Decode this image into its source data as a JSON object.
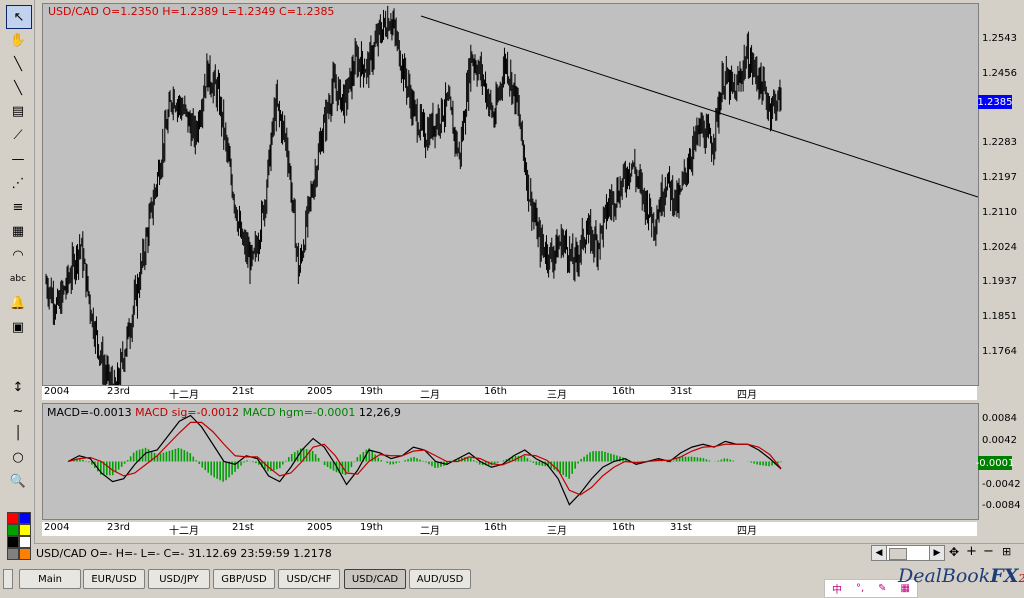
{
  "toolbar": {
    "tools": [
      {
        "name": "pointer-tool",
        "glyph": "↖",
        "selected": true
      },
      {
        "name": "hand-tool",
        "glyph": "✋"
      },
      {
        "name": "trendline-tool",
        "glyph": "╲"
      },
      {
        "name": "ray-tool",
        "glyph": "╲"
      },
      {
        "name": "horizontal-lines-tool",
        "glyph": "▤"
      },
      {
        "name": "fan-tool",
        "glyph": "⟋"
      },
      {
        "name": "hline-tool",
        "glyph": "—"
      },
      {
        "name": "gann-fan-tool",
        "glyph": "⋰"
      },
      {
        "name": "fibonacci-tool",
        "glyph": "≡"
      },
      {
        "name": "grid-tool",
        "glyph": "▦"
      },
      {
        "name": "arc-tool",
        "glyph": "◠"
      },
      {
        "name": "text-tool",
        "glyph": "abc"
      },
      {
        "name": "alert-tool",
        "glyph": "🔔"
      },
      {
        "name": "calculator-tool",
        "glyph": "▣"
      },
      {
        "name": "arrows-tool",
        "glyph": "↕"
      },
      {
        "name": "wave-tool",
        "glyph": "∼"
      },
      {
        "name": "vline-tool",
        "glyph": "│"
      },
      {
        "name": "circle-tool",
        "glyph": "○"
      },
      {
        "name": "zoom-tool",
        "glyph": "🔍"
      }
    ],
    "colors": [
      "#ff0000",
      "#0000ff",
      "#00a000",
      "#ffff00",
      "#000000",
      "#ffffff",
      "#808080",
      "#ff8000"
    ]
  },
  "main_chart": {
    "info": "USD/CAD O=1.2350 H=1.2389 L=1.2349 C=1.2385",
    "price_labels": [
      "1.2543",
      "1.2456",
      "1.2283",
      "1.2197",
      "1.2110",
      "1.2024",
      "1.1937",
      "1.1851",
      "1.1764"
    ],
    "current_price": "1.2385",
    "current_color": "#0000ff"
  },
  "macd_chart": {
    "info_macd": "MACD=-0.0013",
    "info_sig": "MACD sig=-0.0012",
    "info_hgm": "MACD hgm=-0.0001",
    "info_params": "12,26,9",
    "value_labels": [
      "0.0084",
      "0.0042",
      "-0.0042",
      "-0.0084"
    ],
    "current_value": "-0.0001",
    "current_color": "#008000"
  },
  "date_labels": [
    "2004",
    "23rd",
    "十二月",
    "21st",
    "2005",
    "19th",
    "二月",
    "16th",
    "三月",
    "16th",
    "31st",
    "四月"
  ],
  "status": {
    "text": "USD/CAD O=- H=- L=- C=-    31.12.69 23:59:59 1.2178",
    "zoom_plus": "+",
    "zoom_minus": "−"
  },
  "tabs": [
    "Main",
    "EUR/USD",
    "USD/JPY",
    "GBP/USD",
    "USD/CHF",
    "USD/CAD",
    "AUD/USD"
  ],
  "active_tab": 5,
  "brand": {
    "name": "DealBook",
    "suffix": "FX",
    "version": "2"
  },
  "chart_data": [
    {
      "type": "bar",
      "title": "USD/CAD O=1.2350 H=1.2389 L=1.2349 C=1.2385",
      "x": [
        "2004",
        "23rd",
        "十二月",
        "21st",
        "2005",
        "19th",
        "二月",
        "16th",
        "三月",
        "16th",
        "31st",
        "四月"
      ],
      "ylim": [
        1.172,
        1.261
      ],
      "series": [
        {
          "values": [
            1.196,
            1.19,
            1.197,
            1.205,
            1.188,
            1.176,
            1.17,
            1.182,
            1.195,
            1.21,
            1.225,
            1.24,
            1.236,
            1.23,
            1.245,
            1.24,
            1.222,
            1.206,
            1.2,
            1.214,
            1.238,
            1.228,
            1.198,
            1.215,
            1.23,
            1.242,
            1.238,
            1.248,
            1.246,
            1.254,
            1.258,
            1.247,
            1.236,
            1.23,
            1.234,
            1.238,
            1.225,
            1.249,
            1.244,
            1.234,
            1.248,
            1.238,
            1.218,
            1.205,
            1.202,
            1.206,
            1.2,
            1.208,
            1.205,
            1.214,
            1.218,
            1.224,
            1.216,
            1.21,
            1.22,
            1.214,
            1.225,
            1.232,
            1.228,
            1.244,
            1.24,
            1.249,
            1.244,
            1.237,
            1.239
          ]
        }
      ],
      "trendline": [
        [
          1,
          1.2595
        ],
        [
          96,
          1.2175
        ]
      ]
    },
    {
      "type": "line",
      "ylim": [
        -0.01,
        0.01
      ],
      "series": [
        {
          "name": "MACD",
          "values": [
            0.0,
            0.001,
            0.0005,
            -0.002,
            -0.0035,
            -0.003,
            -0.0005,
            0.0015,
            0.002,
            0.0045,
            0.007,
            0.008,
            0.006,
            0.003,
            0.0,
            -0.0005,
            0.001,
            0.0005,
            -0.0025,
            -0.0035,
            -0.001,
            0.002,
            0.004,
            0.0025,
            -0.0005,
            -0.004,
            -0.0015,
            0.002,
            0.0015,
            0.0005,
            0.001,
            0.0025,
            0.002,
            0.0,
            -0.0005,
            0.0005,
            0.0015,
            0.0,
            -0.001,
            -0.0005,
            0.001,
            0.002,
            0.0005,
            -0.0005,
            -0.003,
            -0.0075,
            -0.0055,
            -0.003,
            -0.001,
            0.0,
            0.0005,
            -0.0005,
            0.0,
            0.0005,
            0.0,
            0.0015,
            0.0025,
            0.003,
            0.0025,
            0.0035,
            0.003,
            0.003,
            0.002,
            0.0005,
            -0.0013
          ]
        },
        {
          "name": "MACD sig",
          "values": [
            0.0,
            0.0005,
            0.0007,
            0.0,
            -0.0015,
            -0.0025,
            -0.002,
            -0.0005,
            0.001,
            0.003,
            0.005,
            0.0068,
            0.0068,
            0.0052,
            0.003,
            0.001,
            0.0008,
            0.0008,
            -0.001,
            -0.0025,
            -0.002,
            0.0,
            0.0025,
            0.003,
            0.001,
            -0.002,
            -0.0022,
            0.0,
            0.0012,
            0.001,
            0.001,
            0.0018,
            0.002,
            0.001,
            0.0,
            0.0,
            0.0008,
            0.0005,
            -0.0004,
            -0.0006,
            0.0002,
            0.0012,
            0.001,
            0.0002,
            -0.0015,
            -0.005,
            -0.0058,
            -0.0045,
            -0.0025,
            -0.001,
            0.0,
            -0.0002,
            0.0,
            0.0002,
            0.0002,
            0.0008,
            0.0018,
            0.0025,
            0.0026,
            0.003,
            0.003,
            0.003,
            0.0025,
            0.0012,
            -0.0012
          ]
        }
      ]
    }
  ]
}
